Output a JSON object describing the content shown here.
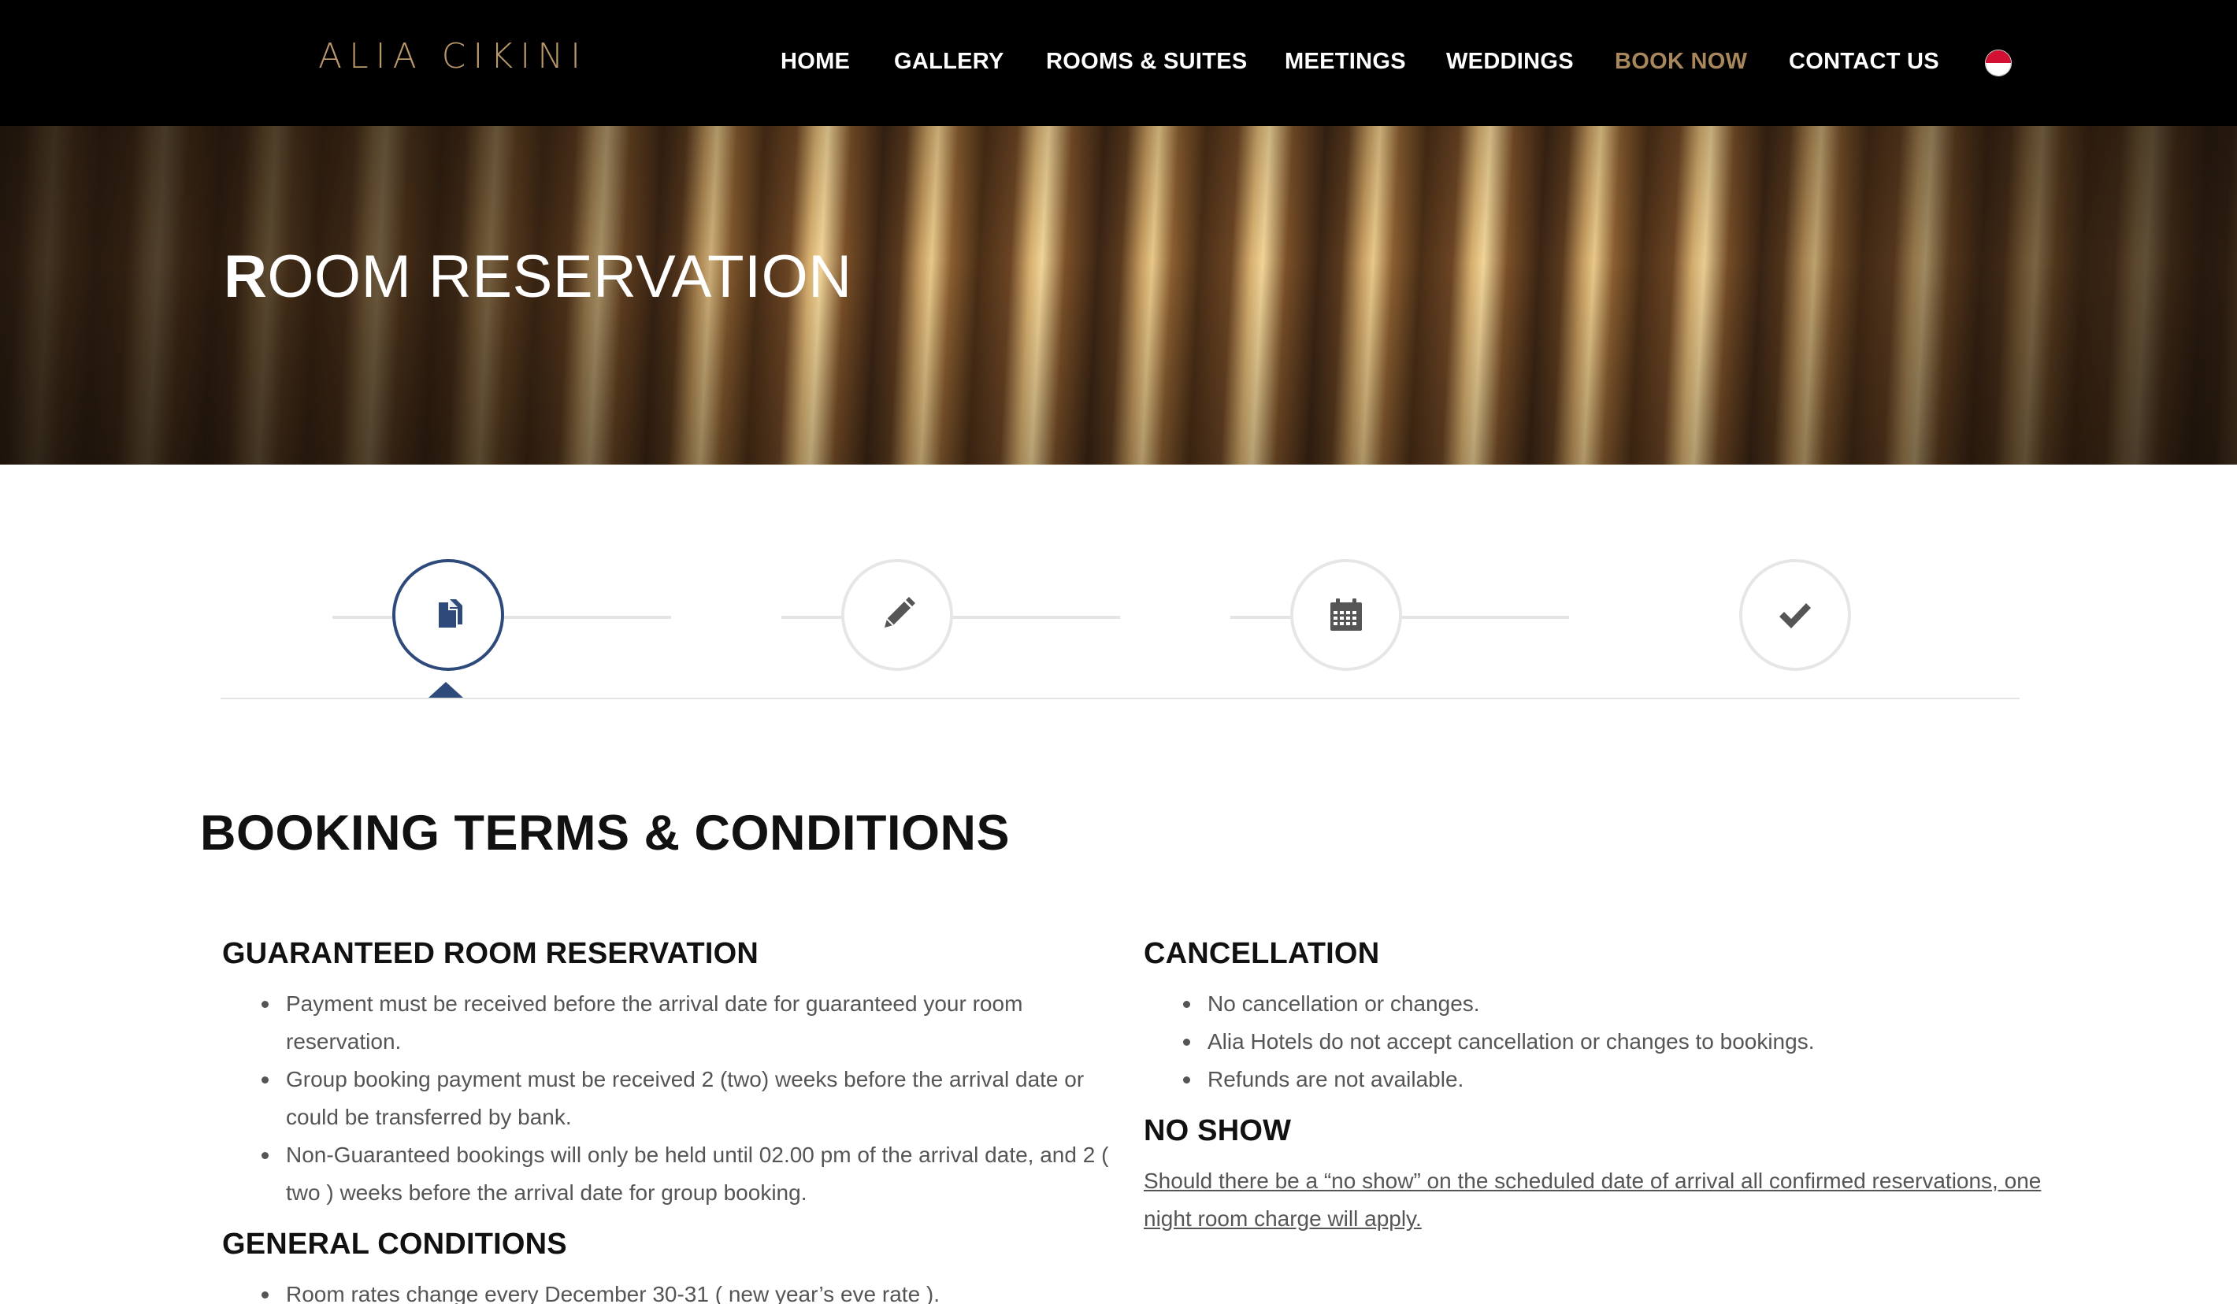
{
  "header": {
    "logo": "ALIA CIKINI",
    "nav": [
      {
        "label": "HOME"
      },
      {
        "label": "GALLERY"
      },
      {
        "label": "ROOMS & SUITES"
      },
      {
        "label": "MEETINGS"
      },
      {
        "label": "WEDDINGS"
      },
      {
        "label": "BOOK NOW",
        "active": true
      },
      {
        "label": "CONTACT US"
      }
    ],
    "language_flag": "indonesia-flag-icon"
  },
  "hero": {
    "title_first": "R",
    "title_rest": "OOM RESERVATION"
  },
  "steps": [
    {
      "icon": "documents-icon",
      "active": true
    },
    {
      "icon": "pencil-icon",
      "active": false
    },
    {
      "icon": "calendar-icon",
      "active": false
    },
    {
      "icon": "checkmark-icon",
      "active": false
    }
  ],
  "colors": {
    "accent": "#a8875d",
    "step_active": "#2d4a7a",
    "header_bg": "#000000"
  },
  "content": {
    "title": "BOOKING TERMS & CONDITIONS",
    "guaranteed": {
      "title": "GUARANTEED ROOM RESERVATION",
      "items": [
        "Payment must be received before the arrival date for guaranteed your room reservation.",
        "Group booking payment must be received 2 (two) weeks before the arrival date or could be transferred by bank.",
        "Non-Guaranteed bookings will only be held until 02.00 pm of the arrival date, and 2 ( two ) weeks before the arrival date for group booking."
      ]
    },
    "general": {
      "title": "GENERAL CONDITIONS",
      "items": [
        "Room rates change every December 30-31 ( new year’s eve rate )."
      ]
    },
    "cancellation": {
      "title": "CANCELLATION",
      "items": [
        "No cancellation or changes.",
        "Alia Hotels do not accept cancellation or changes to bookings.",
        "Refunds are not available."
      ]
    },
    "noshow": {
      "title": "NO SHOW",
      "text": "Should there be a “no show” on the scheduled date of arrival all confirmed reservations, one night room charge will apply."
    }
  }
}
